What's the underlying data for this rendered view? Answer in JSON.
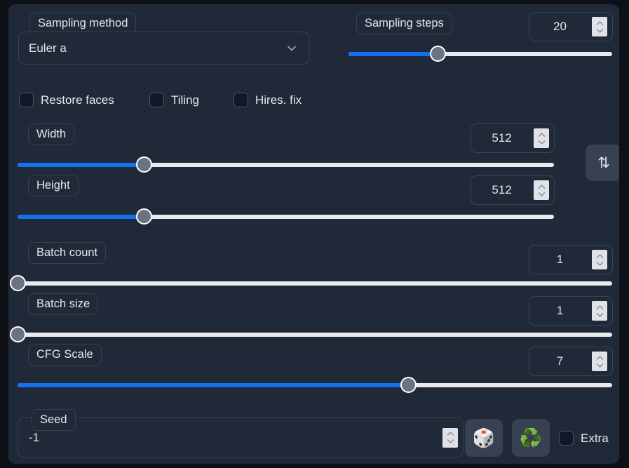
{
  "theme": {
    "page_bg": "#0d1117",
    "panel_bg": "#1f2937",
    "accent": "#1570ef",
    "track": "#e8eaed",
    "thumb": "#6b7280",
    "text": "#e5e7eb",
    "border": "#3a4554"
  },
  "sampling": {
    "method_label": "Sampling method",
    "method_value": "Euler a",
    "method_chevron_icon": "chevron-down-icon",
    "steps_label": "Sampling steps",
    "steps_value": "20",
    "steps_slider": {
      "min": 1,
      "max": 150,
      "value": 20,
      "percent": 34
    }
  },
  "toggles": [
    {
      "label": "Restore faces",
      "checked": false,
      "name": "restore-faces"
    },
    {
      "label": "Tiling",
      "checked": false,
      "name": "tiling"
    },
    {
      "label": "Hires. fix",
      "checked": false,
      "name": "hires-fix"
    }
  ],
  "dimensions": {
    "width_label": "Width",
    "width_value": "512",
    "width_slider": {
      "min": 64,
      "max": 2048,
      "value": 512,
      "percent": 23.6
    },
    "height_label": "Height",
    "height_value": "512",
    "height_slider": {
      "min": 64,
      "max": 2048,
      "value": 512,
      "percent": 23.6
    },
    "swap_icon": "swap-vertical-icon",
    "swap_glyph": "⇅"
  },
  "batch": {
    "count_label": "Batch count",
    "count_value": "1",
    "count_slider": {
      "min": 1,
      "max": 100,
      "value": 1,
      "percent": 0
    },
    "size_label": "Batch size",
    "size_value": "1",
    "size_slider": {
      "min": 1,
      "max": 8,
      "value": 1,
      "percent": 0
    }
  },
  "cfg": {
    "label": "CFG Scale",
    "value": "7",
    "slider": {
      "min": 1,
      "max": 30,
      "value": 7,
      "percent": 65.8
    }
  },
  "seed": {
    "label": "Seed",
    "value": "-1",
    "random_icon": "dice-icon",
    "random_glyph": "🎲",
    "reuse_icon": "recycle-icon",
    "reuse_glyph": "♻️",
    "extra_label": "Extra",
    "extra_checked": false
  }
}
